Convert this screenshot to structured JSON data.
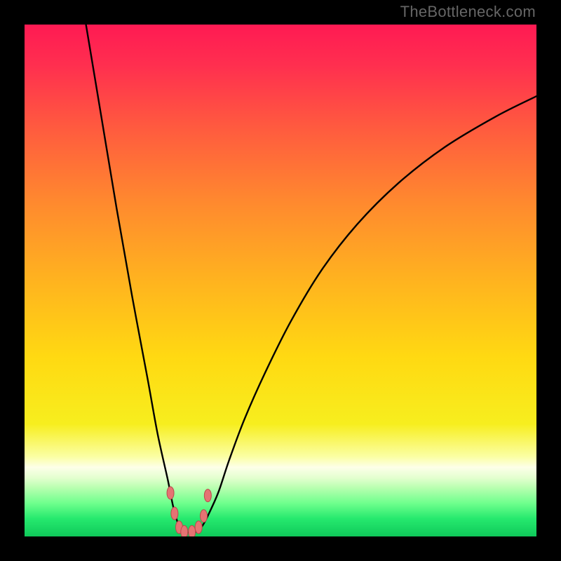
{
  "watermark": "TheBottleneck.com",
  "chart_data": {
    "type": "line",
    "title": "",
    "xlabel": "",
    "ylabel": "",
    "xlim": [
      0,
      100
    ],
    "ylim": [
      0,
      100
    ],
    "series": [
      {
        "name": "curve",
        "x": [
          12,
          15,
          18,
          21,
          24,
          26,
          28,
          29,
          30,
          31,
          32,
          33,
          34,
          35,
          36.5,
          38,
          40,
          43,
          47,
          52,
          58,
          65,
          73,
          82,
          92,
          100
        ],
        "y": [
          100,
          82,
          64,
          47,
          31,
          20,
          11,
          6,
          2.5,
          1.2,
          0.8,
          0.8,
          1.2,
          2.5,
          5.5,
          9,
          15,
          23,
          32,
          42,
          52,
          61,
          69,
          76,
          82,
          86
        ]
      }
    ],
    "markers": {
      "name": "flat-region",
      "x": [
        28.5,
        29.3,
        30.2,
        31.2,
        32.7,
        34.0,
        35.0,
        35.8
      ],
      "y": [
        8.5,
        4.5,
        1.8,
        0.9,
        0.9,
        1.8,
        4.0,
        8.0
      ]
    },
    "gradient_stops": [
      {
        "offset": 0.0,
        "color": "#ff1a53"
      },
      {
        "offset": 0.08,
        "color": "#ff2f4f"
      },
      {
        "offset": 0.2,
        "color": "#ff5a3f"
      },
      {
        "offset": 0.35,
        "color": "#ff8a2e"
      },
      {
        "offset": 0.5,
        "color": "#ffb31f"
      },
      {
        "offset": 0.65,
        "color": "#ffd912"
      },
      {
        "offset": 0.78,
        "color": "#f7ee1e"
      },
      {
        "offset": 0.845,
        "color": "#fbffa6"
      },
      {
        "offset": 0.865,
        "color": "#fdffe8"
      },
      {
        "offset": 0.885,
        "color": "#e4ffd0"
      },
      {
        "offset": 0.905,
        "color": "#b8ffb0"
      },
      {
        "offset": 0.935,
        "color": "#6fff8d"
      },
      {
        "offset": 0.965,
        "color": "#26e96e"
      },
      {
        "offset": 1.0,
        "color": "#0fc95a"
      }
    ],
    "marker_style": {
      "fill": "#e57373",
      "stroke": "#b84c4c",
      "rx": 5,
      "ry": 9
    }
  }
}
